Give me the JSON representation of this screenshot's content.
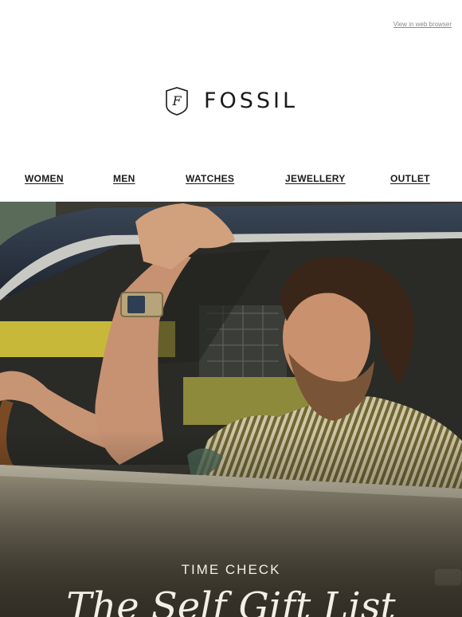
{
  "header": {
    "view_in_browser": "View in web browser"
  },
  "brand": {
    "name": "FOSSIL",
    "monogram": "F"
  },
  "nav": {
    "items": [
      {
        "label": "WOMEN"
      },
      {
        "label": "MEN"
      },
      {
        "label": "WATCHES"
      },
      {
        "label": "JEWELLERY"
      },
      {
        "label": "OUTLET"
      }
    ]
  },
  "hero": {
    "eyebrow": "TIME CHECK",
    "headline": "The Self Gift List"
  },
  "colors": {
    "text": "#1a1a1a",
    "link_muted": "#8a8a8a",
    "hero_text": "#f4efe6",
    "car_roof": "#2e3a4c",
    "car_body": "#a39c83"
  }
}
